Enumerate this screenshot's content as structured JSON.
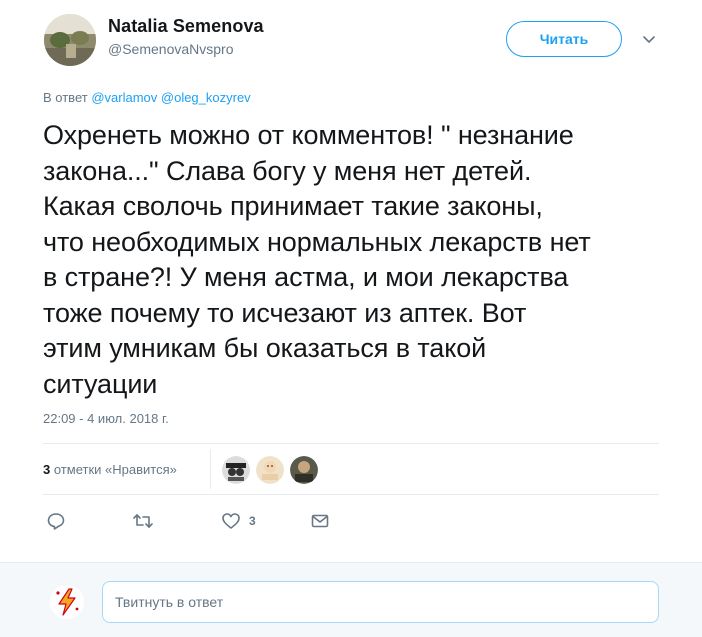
{
  "author": {
    "name": "Natalia Semenova",
    "handle": "@SemenovaNvspro",
    "avatar_icon": "avatar-photo"
  },
  "follow_label": "Читать",
  "reply_to": {
    "prefix": "В ответ",
    "mentions": [
      "@varlamov",
      "@oleg_kozyrev"
    ]
  },
  "tweet_text": "Охренеть можно от комментов! \" незнание\nзакона...\" Слава богу у меня нет детей.\nКакая сволочь принимает такие законы,\nчто необходимых нормальных лекарств нет\nв стране?!  У меня астма, и мои лекарства\nтоже почему то исчезают из аптек. Вот\nэтим умникам бы оказаться в такой\nситуации",
  "timestamp": "22:09 - 4 июл. 2018 г.",
  "stats": {
    "likes_count": "3",
    "likes_label": "отметки «Нравится»"
  },
  "likers": [
    "liker-avatar-1",
    "liker-avatar-2",
    "liker-avatar-3"
  ],
  "actions": {
    "reply_icon": "reply-icon",
    "retweet_icon": "retweet-icon",
    "like_icon": "heart-icon",
    "like_count": "3",
    "dm_icon": "envelope-icon"
  },
  "reply_box": {
    "placeholder": "Твитнуть в ответ"
  },
  "colors": {
    "accent": "#1da1f2",
    "secondary_text": "#657786",
    "border": "#e6ecf0"
  }
}
